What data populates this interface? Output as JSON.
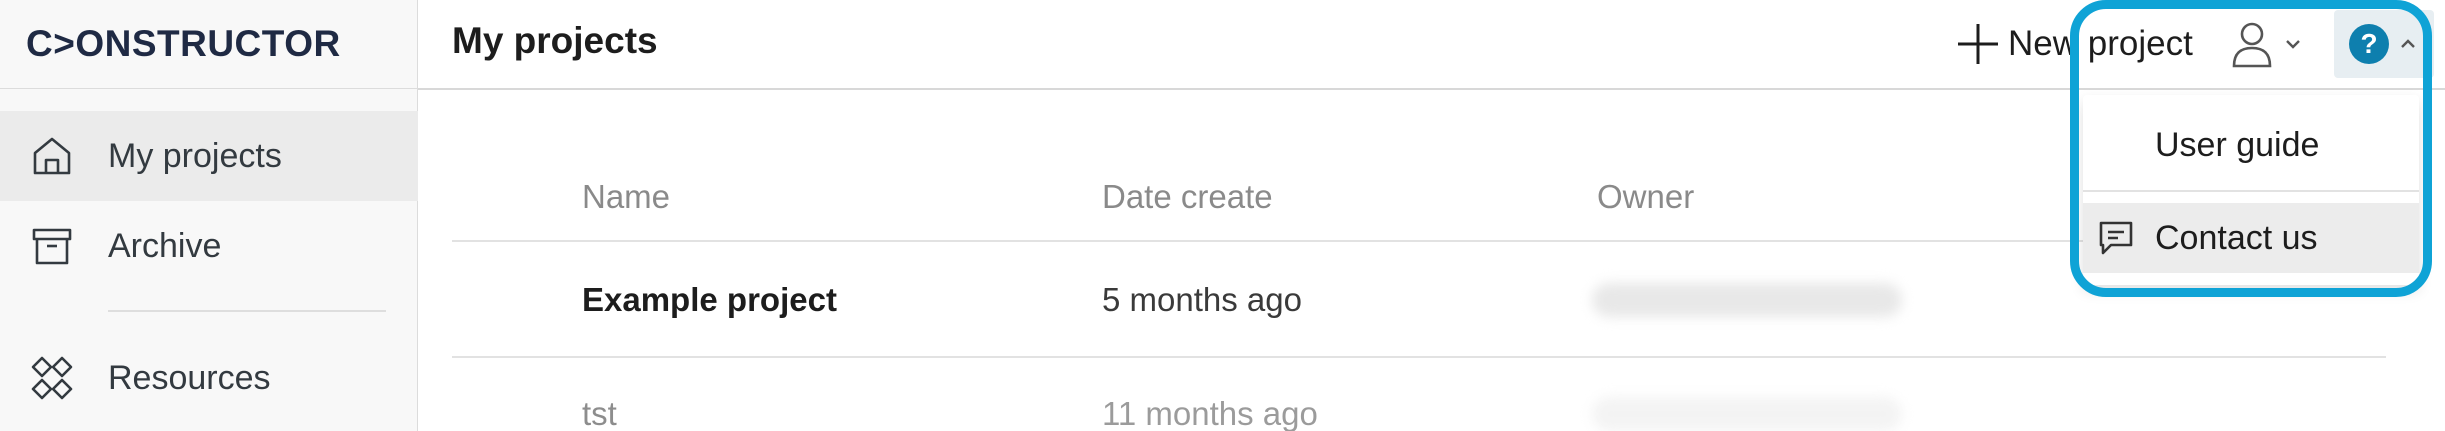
{
  "app": {
    "logo_text": "C>ONSTRUCTOR"
  },
  "sidebar": {
    "items": [
      {
        "label": "My projects",
        "icon": "home-icon",
        "active": true
      },
      {
        "label": "Archive",
        "icon": "archive-icon",
        "active": false
      },
      {
        "label": "Resources",
        "icon": "resources-icon",
        "active": false
      }
    ]
  },
  "header": {
    "title": "My projects",
    "new_project_label": "New project",
    "user_icon": "user-icon",
    "help_icon": "help-icon",
    "help_glyph": "?"
  },
  "table": {
    "columns": [
      "Name",
      "Date create",
      "Owner"
    ],
    "rows": [
      {
        "name": "Example project",
        "date": "5 months ago",
        "owner": ""
      },
      {
        "name": "tst",
        "date": "11 months ago",
        "owner": ""
      }
    ]
  },
  "help_menu": {
    "items": [
      {
        "label": "User guide",
        "icon": ""
      },
      {
        "label": "Contact us",
        "icon": "chat-icon"
      }
    ]
  },
  "colors": {
    "accent": "#0fa3d6",
    "help_button": "#0e7fae",
    "logo": "#1f2a44"
  }
}
